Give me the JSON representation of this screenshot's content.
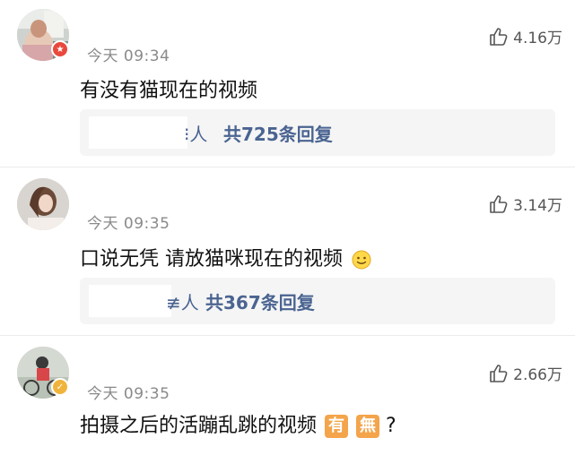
{
  "comments": [
    {
      "time": "今天 09:34",
      "likes": "4.16万",
      "text": "有没有猫现在的视频",
      "reply_prefix": "⁝人",
      "reply_count": "共725条回复",
      "badge_icon": "star-badge-icon"
    },
    {
      "time": "今天 09:35",
      "likes": "3.14万",
      "text": "口说无凭 请放猫咪现在的视频",
      "reply_prefix": "≢人",
      "reply_count": "共367条回复"
    },
    {
      "time": "今天 09:35",
      "likes": "2.66万",
      "text": "拍摄之后的活蹦乱跳的视频",
      "emoji_1": "有",
      "emoji_2": "無",
      "text_end": "?",
      "badge_icon": "verified-badge-icon"
    }
  ],
  "colors": {
    "reply_link": "#4a6491",
    "time": "#8a8a8a",
    "reply_bg": "#f5f5f5",
    "badge_red": "#e8493c",
    "badge_gold": "#f0b43c",
    "emoji_orange": "#f4a44a"
  }
}
